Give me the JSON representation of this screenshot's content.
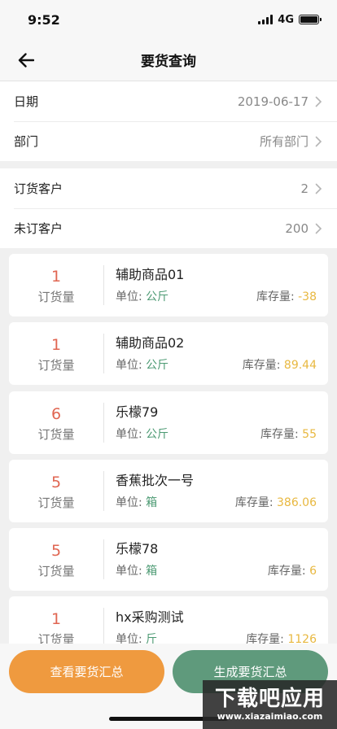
{
  "status_bar": {
    "time": "9:52",
    "network": "4G"
  },
  "nav": {
    "title": "要货查询"
  },
  "filters": [
    {
      "label": "日期",
      "value": "2019-06-17"
    },
    {
      "label": "部门",
      "value": "所有部门"
    }
  ],
  "customers": [
    {
      "label": "订货客户",
      "value": "2"
    },
    {
      "label": "未订客户",
      "value": "200"
    }
  ],
  "labels": {
    "qty": "订货量",
    "unit": "单位: ",
    "stock": "库存量: "
  },
  "items": [
    {
      "qty": "1",
      "name": "辅助商品01",
      "unit": "公斤",
      "stock": "-38"
    },
    {
      "qty": "1",
      "name": "辅助商品02",
      "unit": "公斤",
      "stock": "89.44"
    },
    {
      "qty": "6",
      "name": "乐檬79",
      "unit": "公斤",
      "stock": "55"
    },
    {
      "qty": "5",
      "name": "香蕉批次一号",
      "unit": "箱",
      "stock": "386.06"
    },
    {
      "qty": "5",
      "name": "乐檬78",
      "unit": "箱",
      "stock": "6"
    },
    {
      "qty": "1",
      "name": "hx采购测试",
      "unit": "斤",
      "stock": "1126"
    }
  ],
  "actions": {
    "summary_label": "查看要货汇总",
    "generate_label": "生成要货汇总"
  },
  "watermark": {
    "main": "下载吧应用",
    "sub": "www.xiazaimiao.com"
  },
  "colors": {
    "qty": "#e06652",
    "unit": "#4c9a73",
    "stock": "#e8b840",
    "summary_button": "#ef9a3f",
    "generate_button": "#5f9a7c"
  }
}
